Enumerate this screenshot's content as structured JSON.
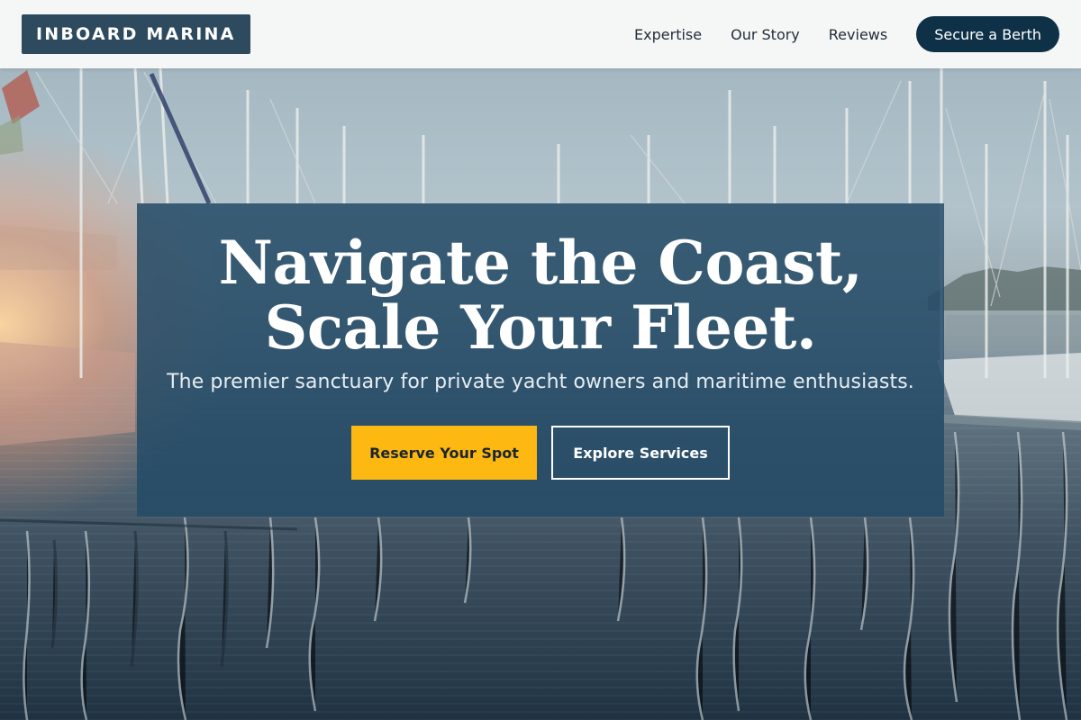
{
  "brand": {
    "name": "INBOARD MARINA"
  },
  "nav": {
    "links": [
      "Expertise",
      "Our Story",
      "Reviews"
    ],
    "cta": "Secure a Berth"
  },
  "hero": {
    "title": "Navigate the Coast, Scale Your Fleet.",
    "subtitle": "The premier sanctuary for private yacht owners and maritime enthusiasts.",
    "primary_button": "Reserve Your Spot",
    "secondary_button": "Explore Services"
  },
  "colors": {
    "brand_dark": "#0f3147",
    "logo_bg": "#2d4a5e",
    "panel_bg": "#244a66",
    "accent_yellow": "#fdb812"
  }
}
